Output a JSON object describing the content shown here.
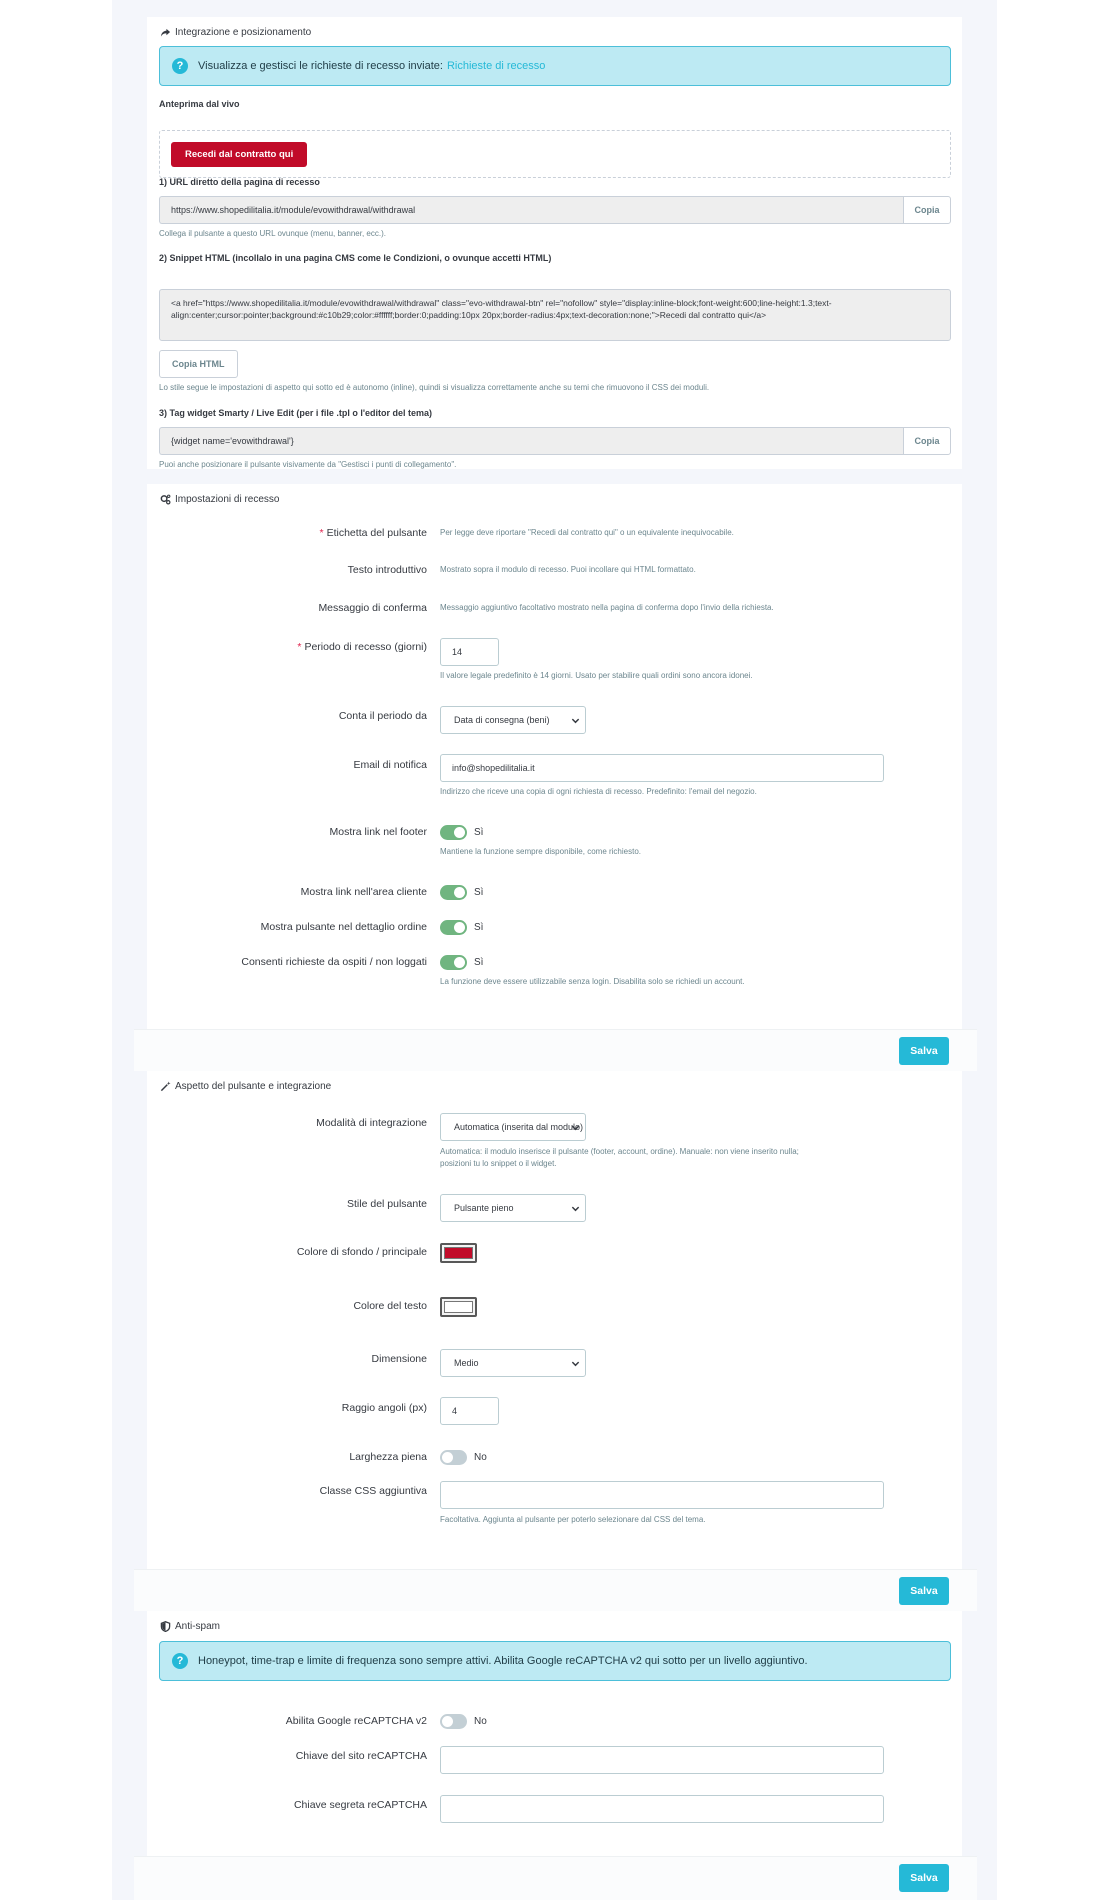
{
  "integration": {
    "heading": "Integrazione e posizionamento",
    "alert_text": "Visualizza e gestisci le richieste di recesso inviate:",
    "alert_link": "Richieste di recesso",
    "preview_label": "Anteprima dal vivo",
    "preview_button": "Recedi dal contratto qui",
    "url_label": "1) URL diretto della pagina di recesso",
    "url_value": "https://www.shopedilitalia.it/module/evowithdrawal/withdrawal",
    "copy_label": "Copia",
    "url_help": "Collega il pulsante a questo URL ovunque (menu, banner, ecc.).",
    "snippet_label": "2) Snippet HTML (incollalo in una pagina CMS come le Condizioni, o ovunque accetti HTML)",
    "snippet_code": "<a href=\"https://www.shopedilitalia.it/module/evowithdrawal/withdrawal\" class=\"evo-withdrawal-btn\" rel=\"nofollow\" style=\"display:inline-block;font-weight:600;line-height:1.3;text-align:center;cursor:pointer;background:#c10b29;color:#ffffff;border:0;padding:10px 20px;border-radius:4px;text-decoration:none;\">Recedi dal contratto qui</a>",
    "copy_html_label": "Copia HTML",
    "snippet_help": "Lo stile segue le impostazioni di aspetto qui sotto ed è autonomo (inline), quindi si visualizza correttamente anche su temi che rimuovono il CSS dei moduli.",
    "widget_label": "3) Tag widget Smarty / Live Edit (per i file .tpl o l'editor del tema)",
    "widget_value": "{widget name='evowithdrawal'}",
    "widget_help": "Puoi anche posizionare il pulsante visivamente da \"Gestisci i punti di collegamento\"."
  },
  "settings": {
    "heading": "Impostazioni di recesso",
    "label_button_label": "Etichetta del pulsante",
    "label_button_help": "Per legge deve riportare \"Recedi dal contratto qui\" o un equivalente inequivocabile.",
    "intro_label": "Testo introduttivo",
    "intro_help": "Mostrato sopra il modulo di recesso. Puoi incollare qui HTML formattato.",
    "confirm_label": "Messaggio di conferma",
    "confirm_help": "Messaggio aggiuntivo facoltativo mostrato nella pagina di conferma dopo l'invio della richiesta.",
    "period_label": "Periodo di recesso (giorni)",
    "period_value": "14",
    "period_help": "Il valore legale predefinito è 14 giorni. Usato per stabilire quali ordini sono ancora idonei.",
    "count_from_label": "Conta il periodo da",
    "count_from_value": "Data di consegna (beni)",
    "email_label": "Email di notifica",
    "email_value": "info@shopedilitalia.it",
    "email_help": "Indirizzo che riceve una copia di ogni richiesta di recesso. Predefinito: l'email del negozio.",
    "footer_link_label": "Mostra link nel footer",
    "footer_link_value": "Sì",
    "footer_link_help": "Mantiene la funzione sempre disponibile, come richiesto.",
    "customer_area_label": "Mostra link nell'area cliente",
    "customer_area_value": "Sì",
    "order_detail_label": "Mostra pulsante nel dettaglio ordine",
    "order_detail_value": "Sì",
    "guests_label": "Consenti richieste da ospiti / non loggati",
    "guests_value": "Sì",
    "guests_help": "La funzione deve essere utilizzabile senza login. Disabilita solo se richiedi un account.",
    "save_label": "Salva"
  },
  "appearance": {
    "heading": "Aspetto del pulsante e integrazione",
    "mode_label": "Modalità di integrazione",
    "mode_value": "Automatica (inserita dal modulo)",
    "mode_help_1": "Automatica: il modulo inserisce il pulsante (footer, account, ordine). Manuale: non viene inserito nulla;",
    "mode_help_2": "posizioni tu lo snippet o il widget.",
    "style_label": "Stile del pulsante",
    "style_value": "Pulsante pieno",
    "bg_color_label": "Colore di sfondo / principale",
    "bg_color": "#c10b29",
    "text_color_label": "Colore del testo",
    "text_color": "#ffffff",
    "size_label": "Dimensione",
    "size_value": "Medio",
    "radius_label": "Raggio angoli (px)",
    "radius_value": "4",
    "full_width_label": "Larghezza piena",
    "full_width_value": "No",
    "css_class_label": "Classe CSS aggiuntiva",
    "css_class_value": "",
    "css_class_help": "Facoltativa. Aggiunta al pulsante per poterlo selezionare dal CSS del tema.",
    "save_label": "Salva"
  },
  "antispam": {
    "heading": "Anti-spam",
    "alert_text": "Honeypot, time-trap e limite di frequenza sono sempre attivi. Abilita Google reCAPTCHA v2 qui sotto per un livello aggiuntivo.",
    "recaptcha_label": "Abilita Google reCAPTCHA v2",
    "recaptcha_value": "No",
    "site_key_label": "Chiave del sito reCAPTCHA",
    "site_key_value": "",
    "secret_key_label": "Chiave segreta reCAPTCHA",
    "secret_key_value": "",
    "save_label": "Salva"
  },
  "colors": {
    "accent": "#25b9d7",
    "danger": "#c10b29",
    "toggle_on": "#70b580"
  }
}
